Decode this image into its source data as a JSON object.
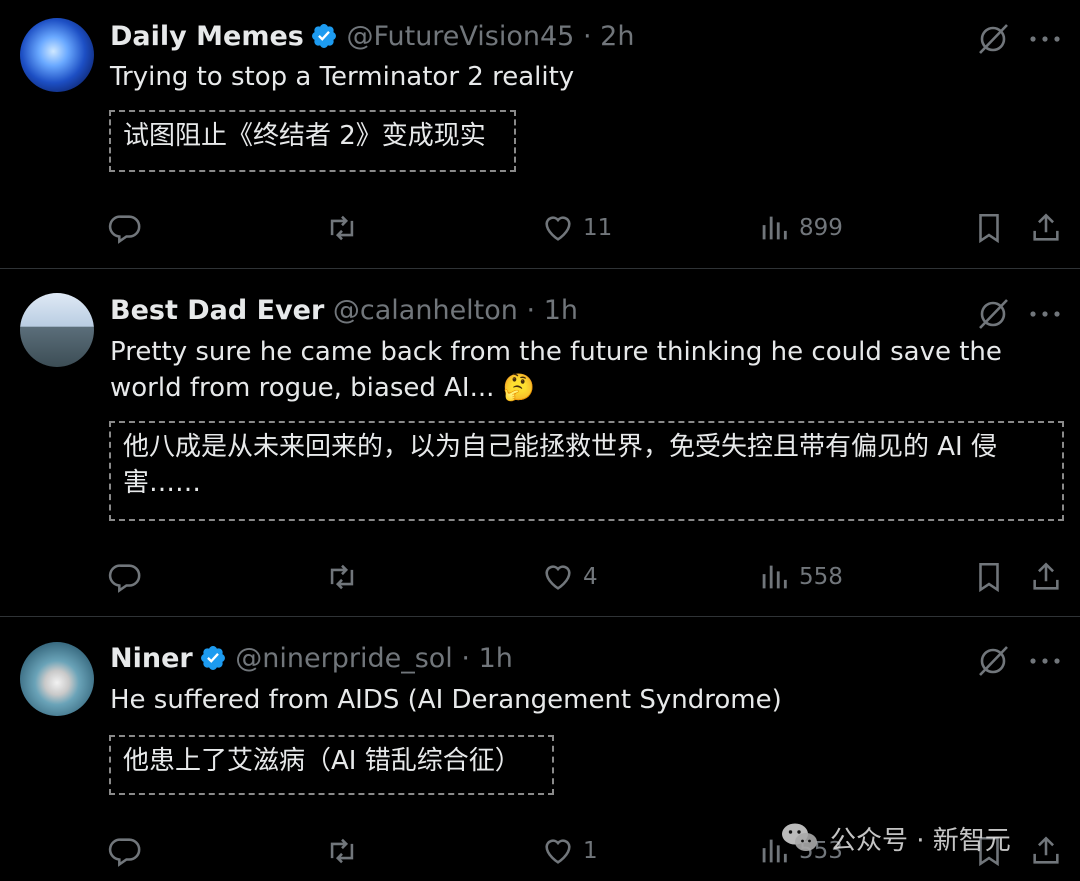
{
  "tweets": [
    {
      "name": "Daily Memes",
      "verified": true,
      "handle": "@FutureVision45",
      "separator": "·",
      "time": "2h",
      "text": "Trying to stop a Terminator 2 reality",
      "translation": "试图阻止《终结者 2》变成现实",
      "replies": "",
      "retweets": "",
      "likes": "11",
      "views": "899"
    },
    {
      "name": "Best Dad Ever",
      "verified": false,
      "handle": "@calanhelton",
      "separator": "·",
      "time": "1h",
      "text": "Pretty sure he came back from the future thinking he could save the world from rogue, biased AI... 🤔",
      "translation": "他八成是从未来回来的，以为自己能拯救世界，免受失控且带有偏见的 AI 侵害……",
      "replies": "",
      "retweets": "",
      "likes": "4",
      "views": "558"
    },
    {
      "name": "Niner",
      "verified": true,
      "handle": "@ninerpride_sol",
      "separator": "·",
      "time": "1h",
      "text": "He suffered from AIDS (AI Derangement Syndrome)",
      "translation": "他患上了艾滋病（AI 错乱综合征）",
      "replies": "",
      "retweets": "",
      "likes": "1",
      "views": "553"
    }
  ],
  "icons": {
    "reply": "reply-icon",
    "retweet": "retweet-icon",
    "like": "heart-icon",
    "views": "views-icon",
    "bookmark": "bookmark-icon",
    "share": "share-icon",
    "grok": "grok-icon",
    "more": "more-icon",
    "verified": "verified-badge-icon"
  },
  "watermark": {
    "text": "公众号 · 新智元",
    "icon": "wechat-icon"
  },
  "colors": {
    "background": "#000000",
    "text": "#e7e9ea",
    "muted": "#71767b",
    "verified": "#1d9bf0",
    "divider": "#2f3336"
  }
}
